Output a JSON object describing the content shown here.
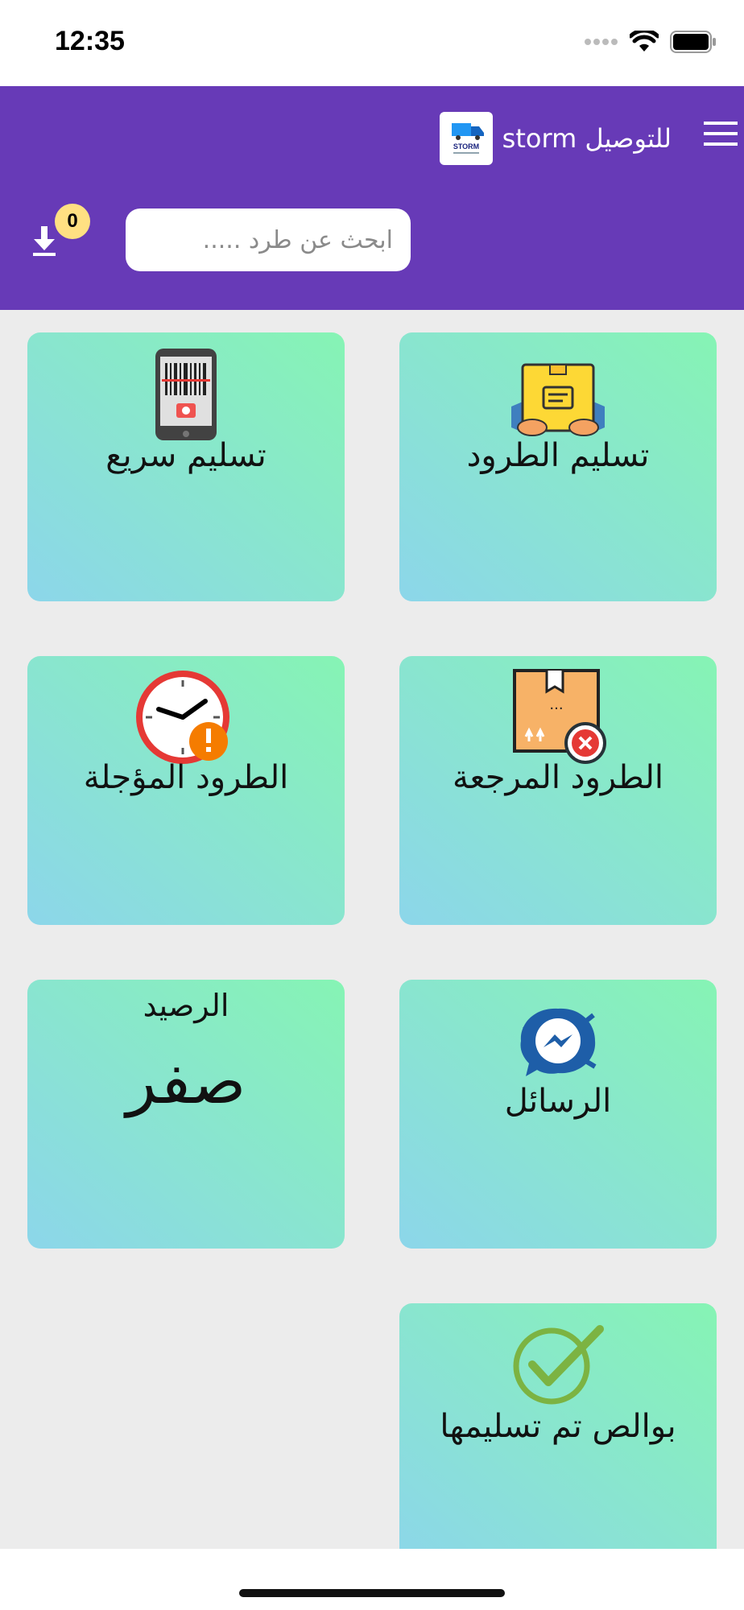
{
  "status": {
    "time": "12:35"
  },
  "header": {
    "title": "storm للتوصيل",
    "logo_text": "STORM",
    "search_placeholder": "ابحث عن طرد .....",
    "badge_count": "0"
  },
  "tiles": {
    "deliver_parcels": "تسليم الطرود",
    "quick_delivery": "تسليم سريع",
    "returned_parcels": "الطرود المرجعة",
    "postponed_parcels": "الطرود المؤجلة",
    "messages": "الرسائل",
    "balance_label": "الرصيد",
    "balance_value": "صفر",
    "delivered_policies": "بوالص تم تسليمها"
  },
  "colors": {
    "header": "#673ab7",
    "tile_top": "#86f4b4",
    "tile_bottom": "#8cd6ea",
    "badge": "#ffe082"
  }
}
